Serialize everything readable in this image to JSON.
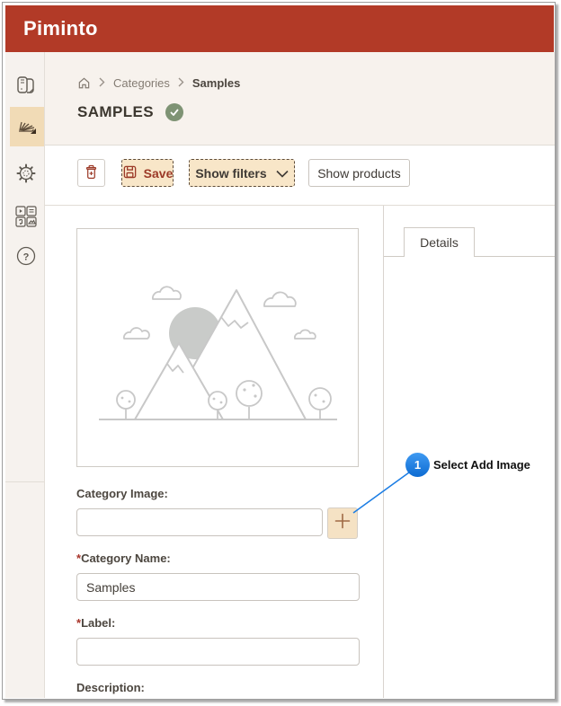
{
  "app": {
    "title": "Piminto"
  },
  "sidebar": {
    "items": [
      {
        "id": "catalog",
        "icon": "book-icon",
        "active": false
      },
      {
        "id": "categories",
        "icon": "categories-icon",
        "active": true
      },
      {
        "id": "settings",
        "icon": "gear-icon",
        "active": false
      },
      {
        "id": "media",
        "icon": "media-grid-icon",
        "active": false
      },
      {
        "id": "help",
        "icon": "help-icon",
        "active": false
      }
    ]
  },
  "breadcrumb": {
    "items": [
      "Categories",
      "Samples"
    ]
  },
  "page": {
    "title": "SAMPLES"
  },
  "toolbar": {
    "save_label": "Save",
    "show_filters_label": "Show filters",
    "show_products_label": "Show products"
  },
  "details_panel": {
    "tab_label": "Details"
  },
  "form": {
    "category_image": {
      "label": "Category Image:",
      "value": ""
    },
    "category_name": {
      "required_mark": "*",
      "label": "Category Name:",
      "value": "Samples"
    },
    "label_field": {
      "required_mark": "*",
      "label": "Label:",
      "value": ""
    },
    "description": {
      "label": "Description:"
    }
  },
  "callout": {
    "step_number": "1",
    "text": "Select Add Image"
  },
  "colors": {
    "header_red": "#b23a27",
    "accent_tan": "#f8e6c8",
    "maroon": "#9c3a28",
    "callout_blue": "#1b7de4",
    "badge_green": "#7e9374"
  }
}
